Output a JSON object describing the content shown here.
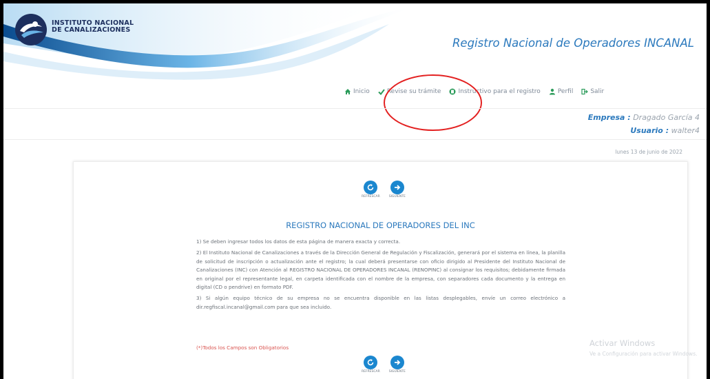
{
  "header": {
    "logo_line1": "INSTITUTO NACIONAL",
    "logo_line2": "DE CANALIZACIONES",
    "site_title": "Registro Nacional de Operadores INCANAL"
  },
  "nav": {
    "items": [
      {
        "label": "Inicio",
        "icon": "home-icon"
      },
      {
        "label": "Revise su trámite",
        "icon": "check-icon"
      },
      {
        "label": "Instructivo para el registro",
        "icon": "document-icon"
      },
      {
        "label": "Perfil",
        "icon": "user-icon"
      },
      {
        "label": "Salir",
        "icon": "logout-icon"
      }
    ]
  },
  "session": {
    "company_label": "Empresa :",
    "company_value": "Dragado García 4",
    "user_label": "Usuario :",
    "user_value": "walter4",
    "date": "lunes 13 de junio de 2022"
  },
  "content": {
    "top_buttons": [
      {
        "label": "REFRESCAR",
        "icon": "refresh-icon"
      },
      {
        "label": "SIGUIENTE",
        "icon": "next-icon"
      }
    ],
    "title": "REGISTRO NACIONAL DE OPERADORES DEL INC",
    "paragraphs": [
      "1) Se deben ingresar todos los datos de esta página de manera exacta y correcta.",
      "2) El Instituto Nacional de Canalizaciones a través de la Dirección General de Regulación y Fiscalización, generará por el sistema en línea, la planilla de solicitud de inscripción o actualización ante el registro; la cual deberá presentarse con oficio dirigido al Presidente del Instituto Nacional de Canalizaciones (INC) con Atención al REGISTRO NACIONAL DE OPERADORES INCANAL (RENOPINC) al consignar los requisitos; debidamente firmada en original por el representante legal, en carpeta identificada con el nombre de la empresa, con separadores cada documento y la entrega en digital (CD o pendrive) en formato PDF.",
      "3) Si algún equipo técnico de su empresa no se encuentra disponible en las listas desplegables, envíe un correo electrónico a dir.regfiscal.incanal@gmail.com para que sea incluido."
    ],
    "required_note": "(*)Todos los Campos son Obligatorios",
    "bottom_buttons": [
      {
        "label": "REFRESCAR",
        "icon": "refresh-icon"
      },
      {
        "label": "SIGUIENTE",
        "icon": "next-icon"
      }
    ]
  },
  "watermark": {
    "line1": "Activar Windows",
    "line2": "Ve a Configuración para activar Windows."
  },
  "colors": {
    "brand_blue": "#2b79bd",
    "button_blue": "#1b87cf",
    "annotation_red": "#e32020",
    "required_red": "#d9534f"
  }
}
